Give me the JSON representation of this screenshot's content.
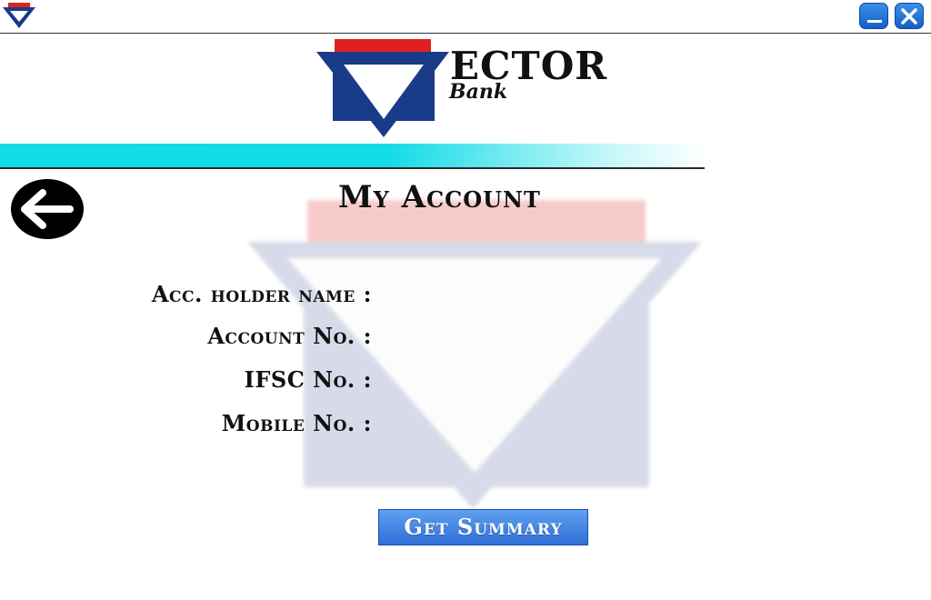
{
  "app": {
    "brand_main": "ECTOR",
    "brand_sub": "Bank"
  },
  "page": {
    "title": "My Account"
  },
  "fields": {
    "holder_name_label": "Acc. holder name :",
    "account_no_label": "Account No. :",
    "ifsc_label": "IFSC No. :",
    "mobile_label": "Mobile No. :"
  },
  "actions": {
    "summary_label": "Get Summary"
  },
  "colors": {
    "brand_red": "#e02020",
    "brand_navy": "#1a3a8a",
    "stripe_cyan": "#12dbe6",
    "button_blue": "#2f6fd8"
  },
  "icons": {
    "app": "vector-logo-icon",
    "minimize": "minimize-icon",
    "close": "close-icon",
    "back": "arrow-left-icon"
  }
}
